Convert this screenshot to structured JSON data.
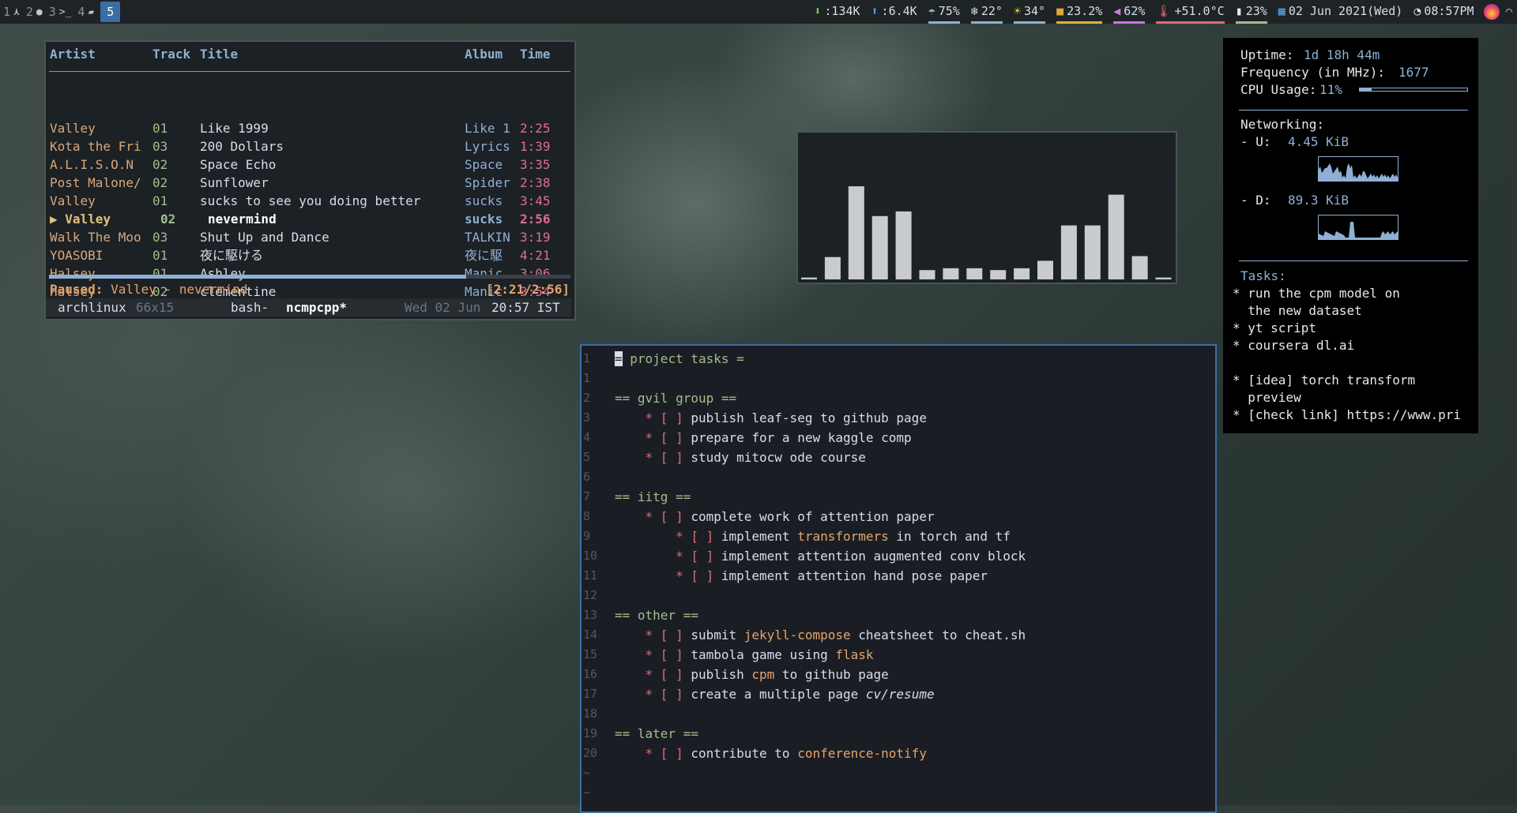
{
  "topbar": {
    "workspaces": [
      {
        "num": "1",
        "icon": "arch-icon",
        "glyph": "⋏"
      },
      {
        "num": "2",
        "icon": "globe-icon",
        "glyph": "●"
      },
      {
        "num": "3",
        "icon": "terminal-icon",
        "glyph": ">_"
      },
      {
        "num": "4",
        "icon": "folder-icon",
        "glyph": "▰"
      }
    ],
    "active_workspace": "5",
    "stats": [
      {
        "name": "download-stat",
        "icon": "download-icon",
        "glyph": "⬇",
        "value": ":134K",
        "underline": "",
        "color": "#7ccf5a"
      },
      {
        "name": "upload-stat",
        "icon": "upload-icon",
        "glyph": "⬆",
        "value": ":6.4K",
        "underline": "",
        "color": "#5aa0e6"
      },
      {
        "name": "weather-stat",
        "icon": "rain-cloud-icon",
        "glyph": "☂",
        "value": "75%",
        "underline": "#8fb0d4",
        "color": "#8fb0d4"
      },
      {
        "name": "temp-low-stat",
        "icon": "snowflake-icon",
        "glyph": "❄",
        "value": "22°",
        "underline": "#8fb0d4",
        "color": "#cfe3f5"
      },
      {
        "name": "temp-high-stat",
        "icon": "sun-icon",
        "glyph": "☀",
        "value": "34°",
        "underline": "#8fb0d4",
        "color": "#f5c542"
      },
      {
        "name": "memory-stat",
        "icon": "package-icon",
        "glyph": "■",
        "value": "23.2%",
        "underline": "#e0b43a",
        "color": "#e0a43a"
      },
      {
        "name": "volume-stat",
        "icon": "speaker-icon",
        "glyph": "◀",
        "value": "62%",
        "underline": "#c678dd",
        "color": "#c678dd"
      },
      {
        "name": "cpu-temp-stat",
        "icon": "thermometer-icon",
        "glyph": "🌡",
        "value": "+51.0°C",
        "underline": "#e06c75",
        "color": "#e06c75"
      },
      {
        "name": "battery-stat",
        "icon": "battery-icon",
        "glyph": "▮",
        "value": "23%",
        "underline": "#a3be8c",
        "color": "#e8e8e8"
      },
      {
        "name": "date-stat",
        "icon": "calendar-icon",
        "glyph": "▦",
        "value": "02 Jun 2021(Wed)",
        "underline": "",
        "color": "#5aa0e6"
      },
      {
        "name": "clock-stat",
        "icon": "clock-icon",
        "glyph": "◔",
        "value": "08:57PM",
        "underline": "",
        "color": "#e8e8e8"
      }
    ]
  },
  "ncmpcpp": {
    "headers": {
      "artist": "Artist",
      "track": "Track",
      "title": "Title",
      "album": "Album",
      "time": "Time"
    },
    "rows": [
      {
        "artist": "Valley",
        "track": "01",
        "title": "Like 1999",
        "album": "Like 1",
        "time": "2:25",
        "playing": false
      },
      {
        "artist": "Kota the Fri",
        "track": "03",
        "title": "200 Dollars",
        "album": "Lyrics",
        "time": "1:39",
        "playing": false
      },
      {
        "artist": "A.L.I.S.O.N",
        "track": "02",
        "title": "Space Echo",
        "album": "Space",
        "time": "3:35",
        "playing": false
      },
      {
        "artist": "Post Malone/",
        "track": "02",
        "title": "Sunflower",
        "album": "Spider",
        "time": "2:38",
        "playing": false
      },
      {
        "artist": "Valley",
        "track": "01",
        "title": "sucks to see you doing better",
        "album": "sucks",
        "time": "3:45",
        "playing": false
      },
      {
        "artist": "▶ Valley",
        "track": "02",
        "title": "nevermind",
        "album": "sucks",
        "time": "2:56",
        "playing": true
      },
      {
        "artist": "Walk The Moo",
        "track": "03",
        "title": "Shut Up and Dance",
        "album": "TALKIN",
        "time": "3:19",
        "playing": false
      },
      {
        "artist": "YOASOBI",
        "track": "01",
        "title": "夜に駆ける",
        "album": "夜に駆",
        "time": "4:21",
        "playing": false
      },
      {
        "artist": "Halsey",
        "track": "01",
        "title": "Ashley",
        "album": "Manic",
        "time": "3:06",
        "playing": false
      },
      {
        "artist": "Halsey",
        "track": "02",
        "title": "clementine",
        "album": "Manic",
        "time": "3:54",
        "playing": false
      }
    ],
    "progress": 0.8,
    "status_label": "Paused:",
    "status_text": "Valley - nevermind",
    "status_time": "[2:21/2:56]",
    "tmux": {
      "host": "archlinux",
      "size": "66x15",
      "win1": "bash-",
      "win2": "ncmpcpp*",
      "date": "Wed 02 Jun",
      "time": "20:57 IST"
    }
  },
  "visualizer": {
    "levels": [
      0.02,
      0.24,
      1.0,
      0.68,
      0.73,
      0.1,
      0.12,
      0.12,
      0.1,
      0.12,
      0.2,
      0.58,
      0.58,
      0.91,
      0.25,
      0.02
    ]
  },
  "conky": {
    "uptime_label": "Uptime:",
    "uptime_value": "1d 18h 44m",
    "freq_label": "Frequency (in MHz):",
    "freq_value": "1677",
    "cpu_label": "CPU Usage:",
    "cpu_value": "11%",
    "cpu_fraction": 0.11,
    "networking_label": "Networking:",
    "up_label": "- U:",
    "up_value": "4.45 KiB",
    "down_label": "- D:",
    "down_value": "89.3 KiB",
    "tasks_label": "Tasks:",
    "tasks": [
      "* run the cpm model on",
      "  the new dataset",
      "* yt script",
      "* coursera dl.ai",
      "",
      "* [idea] torch transform",
      "  preview",
      "* [check link] https://www.pri"
    ]
  },
  "editor": {
    "lines": [
      {
        "num": "1",
        "segs": [
          {
            "t": "=",
            "c": "cursor"
          },
          {
            "t": " project tasks =",
            "c": "hd"
          }
        ]
      },
      {
        "num": "1",
        "segs": []
      },
      {
        "num": "2",
        "segs": [
          {
            "t": "== gvil group ==",
            "c": "hd"
          }
        ]
      },
      {
        "num": "3",
        "segs": [
          {
            "t": "    * [ ] ",
            "c": "bul"
          },
          {
            "t": "publish leaf-seg to github page",
            "c": ""
          }
        ]
      },
      {
        "num": "4",
        "segs": [
          {
            "t": "    * [ ] ",
            "c": "bul"
          },
          {
            "t": "prepare for a new kaggle comp",
            "c": ""
          }
        ]
      },
      {
        "num": "5",
        "segs": [
          {
            "t": "    * [ ] ",
            "c": "bul"
          },
          {
            "t": "study mitocw ode course",
            "c": ""
          }
        ]
      },
      {
        "num": "6",
        "segs": []
      },
      {
        "num": "7",
        "segs": [
          {
            "t": "== iitg ==",
            "c": "hd"
          }
        ]
      },
      {
        "num": "8",
        "segs": [
          {
            "t": "    * [ ] ",
            "c": "bul"
          },
          {
            "t": "complete work of attention paper",
            "c": ""
          }
        ]
      },
      {
        "num": "9",
        "segs": [
          {
            "t": "        * [ ] ",
            "c": "bul"
          },
          {
            "t": "implement ",
            "c": ""
          },
          {
            "t": "transformers",
            "c": "hl"
          },
          {
            "t": " in torch and tf",
            "c": ""
          }
        ]
      },
      {
        "num": "10",
        "segs": [
          {
            "t": "        * [ ] ",
            "c": "bul"
          },
          {
            "t": "implement attention augmented conv block",
            "c": ""
          }
        ]
      },
      {
        "num": "11",
        "segs": [
          {
            "t": "        * [ ] ",
            "c": "bul"
          },
          {
            "t": "implement attention hand pose paper",
            "c": ""
          }
        ]
      },
      {
        "num": "12",
        "segs": []
      },
      {
        "num": "13",
        "segs": [
          {
            "t": "== other ==",
            "c": "hd"
          }
        ]
      },
      {
        "num": "14",
        "segs": [
          {
            "t": "    * [ ] ",
            "c": "bul"
          },
          {
            "t": "submit ",
            "c": ""
          },
          {
            "t": "jekyll-compose",
            "c": "hl"
          },
          {
            "t": " cheatsheet to cheat.sh",
            "c": ""
          }
        ]
      },
      {
        "num": "15",
        "segs": [
          {
            "t": "    * [ ] ",
            "c": "bul"
          },
          {
            "t": "tambola game using ",
            "c": ""
          },
          {
            "t": "flask",
            "c": "hl"
          }
        ]
      },
      {
        "num": "16",
        "segs": [
          {
            "t": "    * [ ] ",
            "c": "bul"
          },
          {
            "t": "publish ",
            "c": ""
          },
          {
            "t": "cpm",
            "c": "hl"
          },
          {
            "t": " to github page",
            "c": ""
          }
        ]
      },
      {
        "num": "17",
        "segs": [
          {
            "t": "    * [ ] ",
            "c": "bul"
          },
          {
            "t": "create a multiple page ",
            "c": ""
          },
          {
            "t": "cv/resume",
            "c": "it"
          }
        ]
      },
      {
        "num": "18",
        "segs": []
      },
      {
        "num": "19",
        "segs": [
          {
            "t": "== later ==",
            "c": "hd"
          }
        ]
      },
      {
        "num": "20",
        "segs": [
          {
            "t": "    * [ ] ",
            "c": "bul"
          },
          {
            "t": "contribute to ",
            "c": ""
          },
          {
            "t": "conference-notify",
            "c": "hl"
          }
        ]
      },
      {
        "num": "~",
        "segs": []
      },
      {
        "num": "~",
        "segs": []
      }
    ]
  }
}
